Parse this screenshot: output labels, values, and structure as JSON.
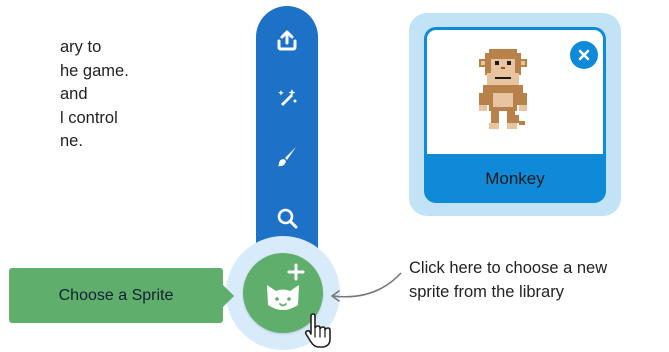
{
  "intro_text": [
    "ary to",
    "he game.",
    "and",
    "l control",
    "ne."
  ],
  "sprite_card": {
    "name": "Monkey"
  },
  "choose_sprite": {
    "tooltip": "Choose a Sprite"
  },
  "callout": {
    "line1": "Click here to choose a new",
    "line2": "sprite from the library"
  },
  "colors": {
    "strip": "#1d72c8",
    "choose": "#5fae6c",
    "card": "#0f8ad8",
    "card_outer": "#c2e2f6",
    "halo": "#d7ebfb"
  },
  "icons": [
    "upload-icon",
    "surprise-icon",
    "paint-icon",
    "search-icon",
    "cat-icon",
    "plus-icon",
    "close-icon",
    "hand-pointer-icon",
    "monkey-sprite"
  ]
}
